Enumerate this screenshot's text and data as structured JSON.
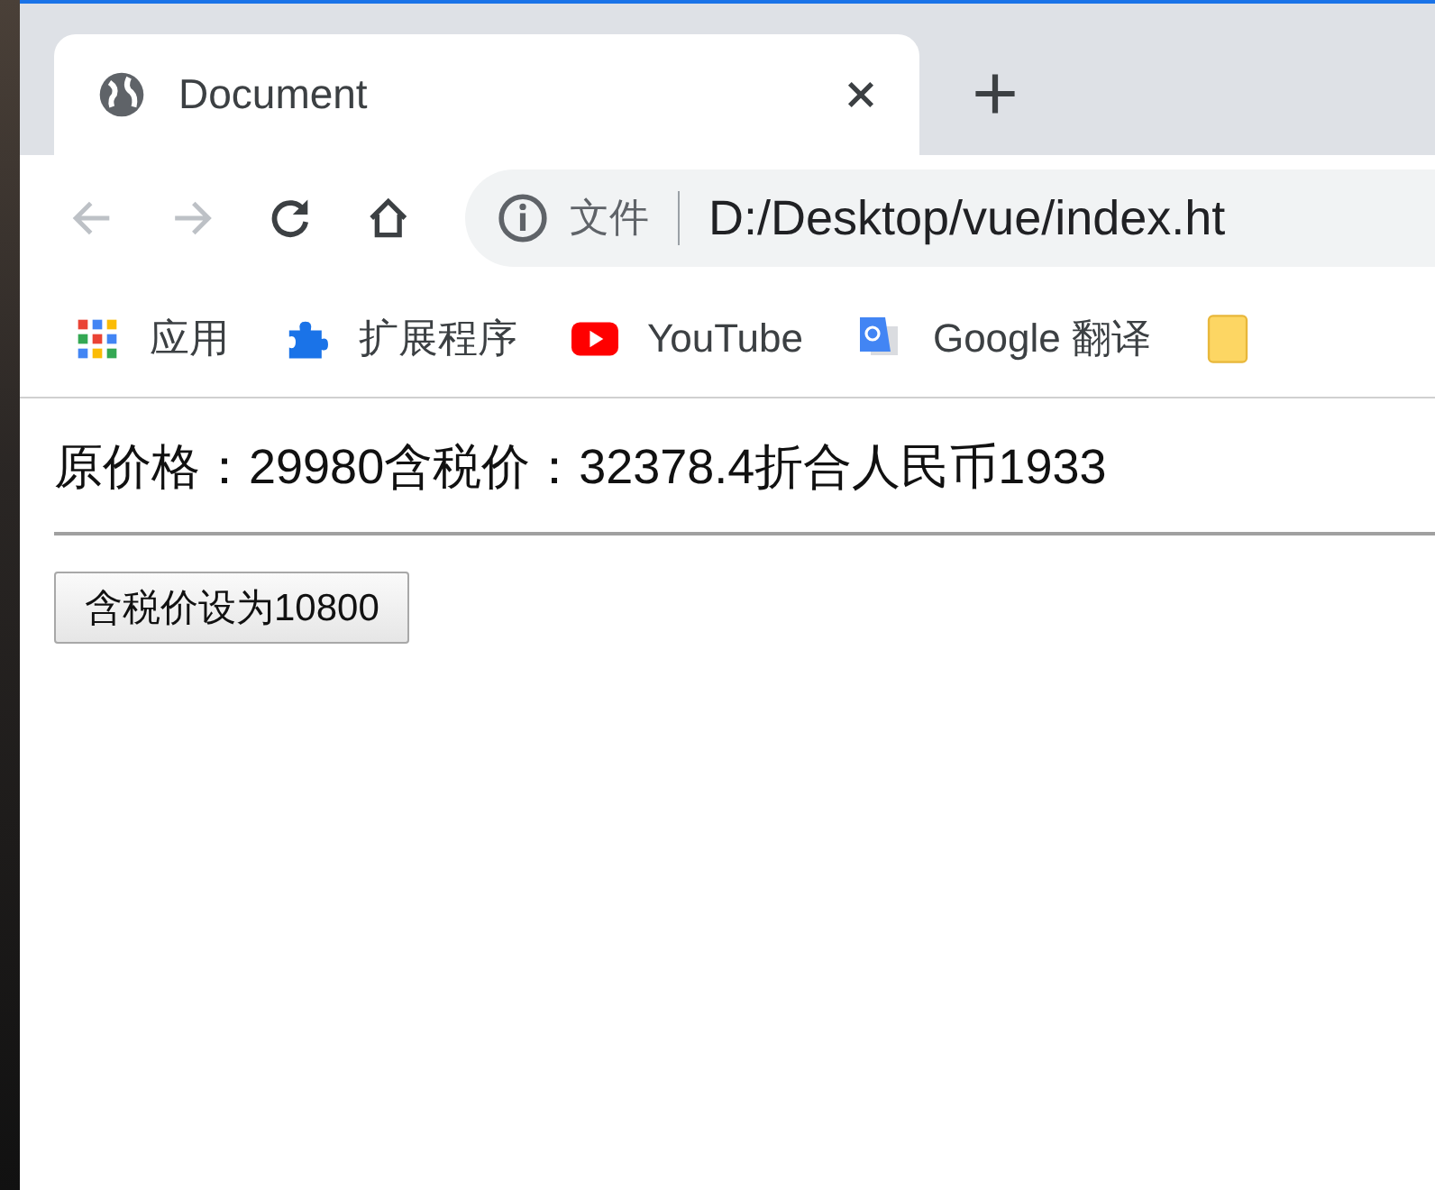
{
  "tab": {
    "title": "Document",
    "selected": true
  },
  "address_bar": {
    "security_label": "文件",
    "url": "D:/Desktop/vue/index.ht"
  },
  "bookmarks": [
    {
      "kind": "apps",
      "label": "应用"
    },
    {
      "kind": "extensions",
      "label": "扩展程序"
    },
    {
      "kind": "youtube",
      "label": "YouTube"
    },
    {
      "kind": "translate",
      "label": "Google 翻译"
    },
    {
      "kind": "folder"
    }
  ],
  "page": {
    "price_line": "原价格：29980含税价：32378.4折合人民币1933",
    "button": "含税价设为10800"
  }
}
